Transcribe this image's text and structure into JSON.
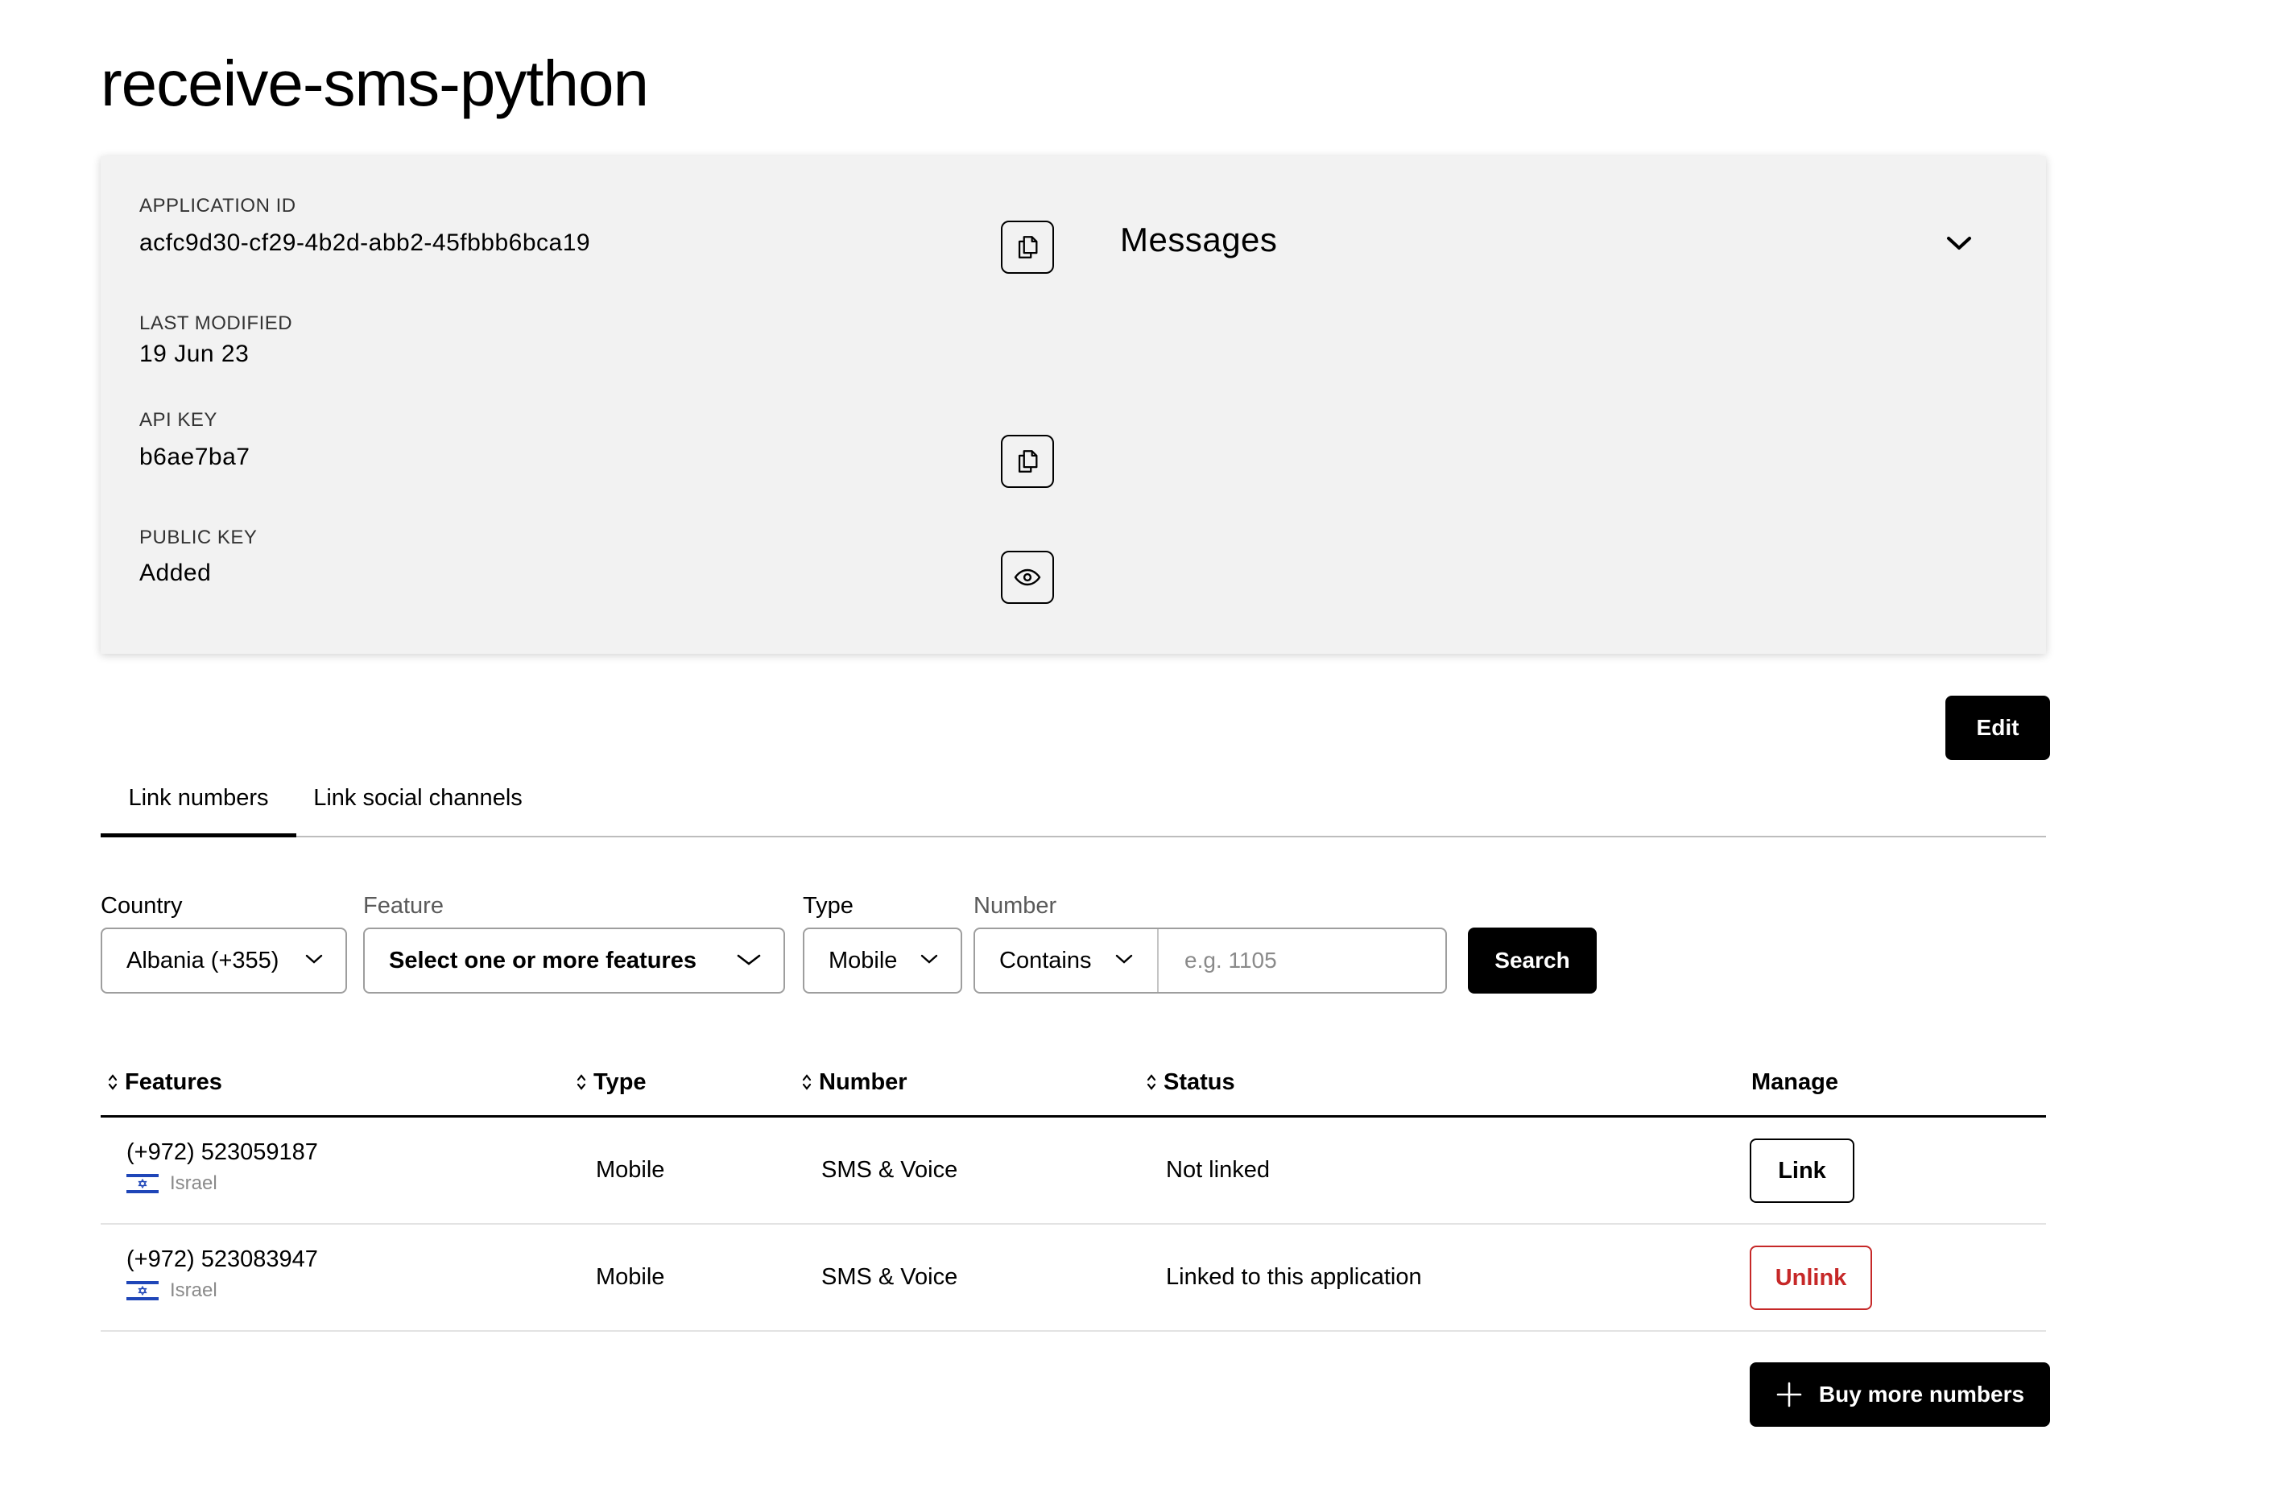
{
  "page": {
    "title": "receive-sms-python"
  },
  "app_info": {
    "application_id_label": "APPLICATION ID",
    "application_id": "acfc9d30-cf29-4b2d-abb2-45fbbb6bca19",
    "last_modified_label": "LAST MODIFIED",
    "last_modified": "19 Jun 23",
    "api_key_label": "API KEY",
    "api_key": "b6ae7ba7",
    "public_key_label": "PUBLIC KEY",
    "public_key": "Added",
    "capability_title": "Messages"
  },
  "actions": {
    "edit_label": "Edit",
    "search_label": "Search",
    "buy_numbers_label": "Buy more numbers"
  },
  "tabs": [
    {
      "label": "Link numbers",
      "active": true
    },
    {
      "label": "Link social channels",
      "active": false
    }
  ],
  "filters": {
    "country_label": "Country",
    "country_value": "Albania (+355)",
    "feature_label": "Feature",
    "feature_value": "Select one or more features",
    "type_label": "Type",
    "type_value": "Mobile",
    "number_label": "Number",
    "number_mode": "Contains",
    "number_placeholder": "e.g. 1105"
  },
  "table": {
    "columns": [
      "Features",
      "Type",
      "Number",
      "Status",
      "Manage"
    ],
    "rows": [
      {
        "phone": "(+972) 523059187",
        "country": "Israel",
        "type": "Mobile",
        "number": "SMS & Voice",
        "status": "Not linked",
        "action": "Link"
      },
      {
        "phone": "(+972) 523083947",
        "country": "Israel",
        "type": "Mobile",
        "number": "SMS & Voice",
        "status": "Linked to this application",
        "action": "Unlink"
      }
    ]
  },
  "colors": {
    "primary": "#000000",
    "card_bg": "#f2f2f2",
    "danger": "#c62828",
    "flag_blue": "#1f46b8"
  },
  "icons": {
    "copy": "copy-icon",
    "eye": "eye-icon",
    "chevron": "chevron-down-icon",
    "sort": "sort-icon",
    "plus": "plus-icon",
    "flag": "israel-flag-icon"
  }
}
